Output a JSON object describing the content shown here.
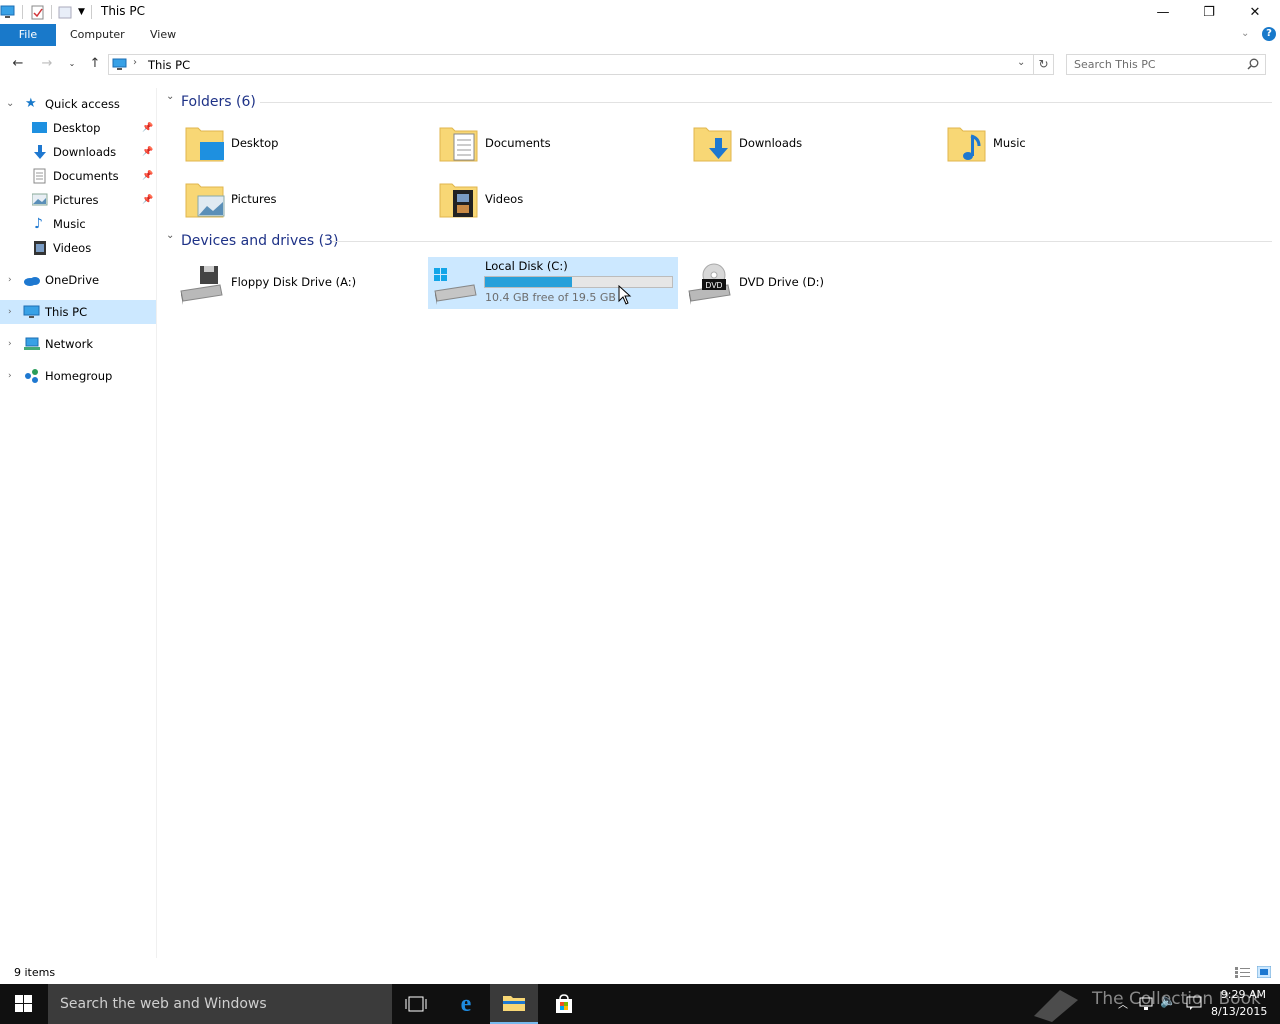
{
  "window": {
    "title": "This PC",
    "minimize": "—",
    "restore": "❐",
    "close": "✕"
  },
  "ribbon": {
    "tabs": [
      "File",
      "Computer",
      "View"
    ],
    "help": "?"
  },
  "address": {
    "path": "This PC",
    "search_placeholder": "Search This PC"
  },
  "nav": {
    "quick_access": "Quick access",
    "quick_items": [
      {
        "label": "Desktop",
        "icon": "desktop-icon",
        "pinned": true
      },
      {
        "label": "Downloads",
        "icon": "downloads-icon",
        "pinned": true
      },
      {
        "label": "Documents",
        "icon": "documents-icon",
        "pinned": true
      },
      {
        "label": "Pictures",
        "icon": "pictures-icon",
        "pinned": true
      },
      {
        "label": "Music",
        "icon": "music-icon",
        "pinned": false
      },
      {
        "label": "Videos",
        "icon": "videos-icon",
        "pinned": false
      }
    ],
    "onedrive": "OneDrive",
    "this_pc": "This PC",
    "network": "Network",
    "homegroup": "Homegroup"
  },
  "content": {
    "folders_header": "Folders (6)",
    "folders": [
      "Desktop",
      "Documents",
      "Downloads",
      "Music",
      "Pictures",
      "Videos"
    ],
    "drives_header": "Devices and drives (3)",
    "drives": [
      {
        "label": "Floppy Disk Drive (A:)",
        "icon": "floppy-drive-icon"
      },
      {
        "label": "Local Disk (C:)",
        "icon": "local-disk-icon",
        "free": "10.4 GB free of 19.5 GB",
        "used_fraction": 0.467
      },
      {
        "label": "DVD Drive (D:)",
        "icon": "dvd-drive-icon",
        "badge": "DVD"
      }
    ]
  },
  "status": {
    "items": "9 items"
  },
  "taskbar": {
    "search": "Search the web and Windows",
    "time": "9:29 AM",
    "date": "8/13/2015",
    "watermark": "The Collection Book"
  },
  "colors": {
    "accent": "#1979ca",
    "selection": "#cce8ff",
    "header_text": "#1e3287",
    "bar_fill": "#26a0da",
    "folder": "#f8d775"
  }
}
